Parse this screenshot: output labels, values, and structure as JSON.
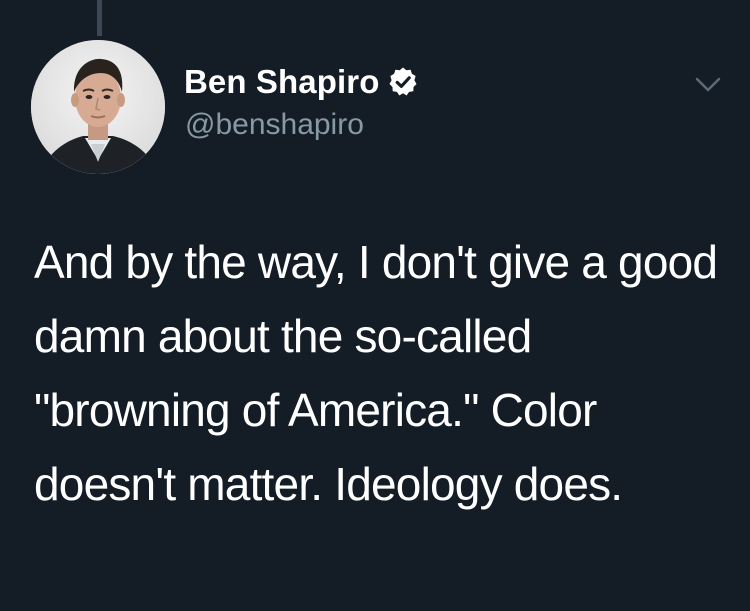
{
  "tweet": {
    "display_name": "Ben Shapiro",
    "handle": "@benshapiro",
    "text": "And by the way, I don't give a good damn about the so-called \"browning of America.\" Color doesn't matter. Ideology does."
  },
  "icons": {
    "verified": "verified-badge-icon",
    "menu": "chevron-down-icon"
  },
  "colors": {
    "background": "#141d26",
    "text": "#ffffff",
    "secondary": "#8899a6",
    "thread_line": "#3b4753"
  }
}
